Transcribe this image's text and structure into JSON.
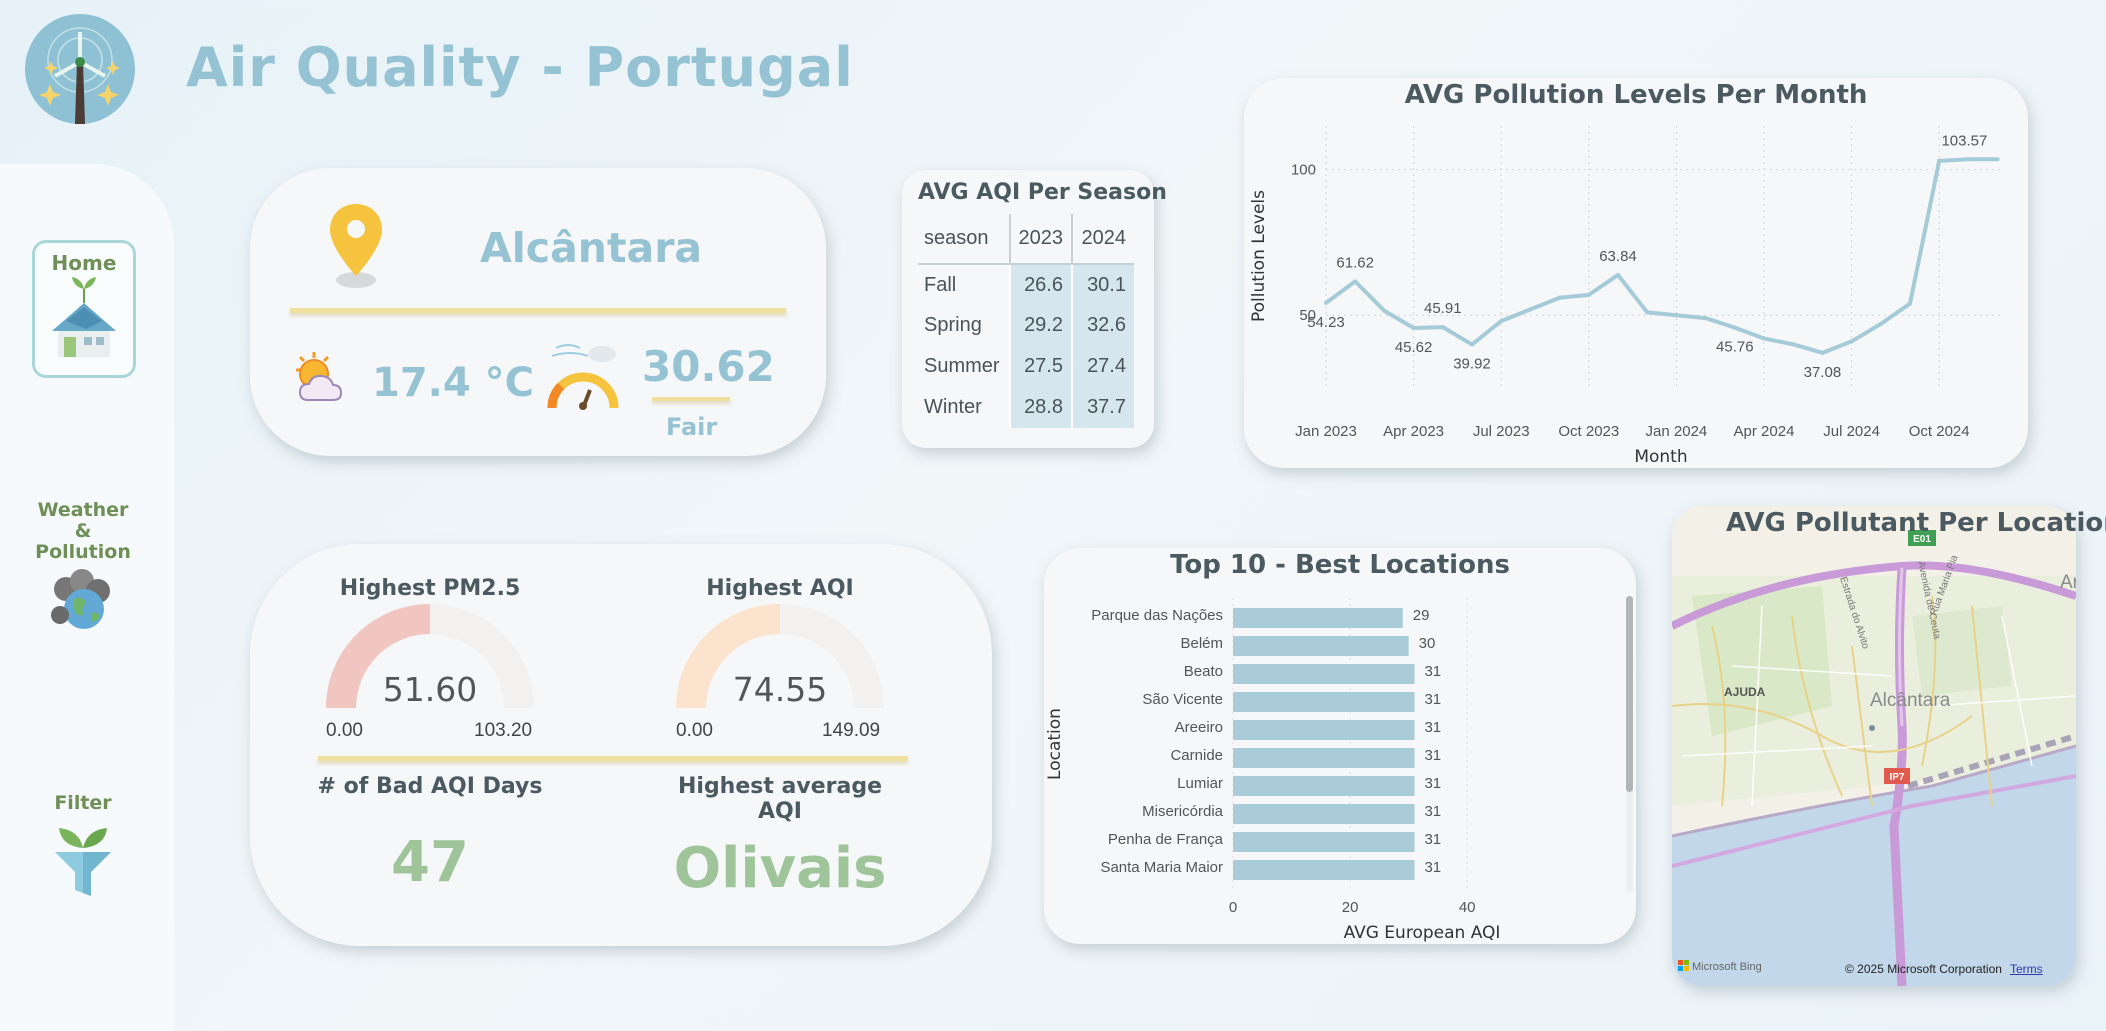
{
  "app": {
    "title": "Air Quality - Portugal"
  },
  "sidebar": {
    "items": [
      {
        "label": "Home"
      },
      {
        "label": "Weather\n&\nPollution"
      },
      {
        "label": "Filter"
      }
    ]
  },
  "location_card": {
    "location": "Alcântara",
    "temperature": "17.4 °C",
    "aqi": "30.62",
    "aqi_category": "Fair"
  },
  "season_table": {
    "title": "AVG AQI Per Season",
    "columns": [
      "season",
      "2023",
      "2024"
    ],
    "rows": [
      [
        "Fall",
        "26.6",
        "30.1"
      ],
      [
        "Spring",
        "29.2",
        "32.6"
      ],
      [
        "Summer",
        "27.5",
        "27.4"
      ],
      [
        "Winter",
        "28.8",
        "37.7"
      ]
    ]
  },
  "kpis": {
    "pm25_title": "Highest PM2.5",
    "pm25_value": "51.60",
    "pm25_min": "0.00",
    "pm25_max": "103.20",
    "pm25_fraction": 0.5,
    "aqi_title": "Highest AQI",
    "aqi_value": "74.55",
    "aqi_min": "0.00",
    "aqi_max": "149.09",
    "aqi_fraction": 0.5,
    "bad_days_title": "# of Bad AQI Days",
    "bad_days_value": "47",
    "highest_avg_title": "Highest average AQI",
    "highest_avg_value": "Olivais"
  },
  "map": {
    "title": "AVG Pollutant Per Location",
    "place_label": "Alcântara",
    "district_label": "AJUDA",
    "road_labels": [
      "E01",
      "IP7"
    ],
    "street_labels": [
      "Estrada do Alvito",
      "Avenida de Ceuta",
      "Rua Maria Pia"
    ],
    "edge_label": "Ar",
    "provider": "Microsoft Bing",
    "copyright": "© 2025 Microsoft Corporation",
    "terms": "Terms"
  },
  "colors": {
    "accent": "#95c3d3",
    "line": "#a5cbd8",
    "bar": "#a9ccd8",
    "kpi_green": "#9fc49a",
    "gauge_pm": "#f1c6c0",
    "gauge_aqi": "#fce3cd"
  },
  "chart_data": [
    {
      "type": "line",
      "title": "AVG Pollution Levels Per Month",
      "xlabel": "Month",
      "ylabel": "Pollution Levels",
      "x": [
        "2023-01",
        "2023-02",
        "2023-03",
        "2023-04",
        "2023-05",
        "2023-06",
        "2023-07",
        "2023-08",
        "2023-09",
        "2023-10",
        "2023-11",
        "2023-12",
        "2024-01",
        "2024-02",
        "2024-03",
        "2024-04",
        "2024-05",
        "2024-06",
        "2024-07",
        "2024-08",
        "2024-09",
        "2024-10",
        "2024-11",
        "2024-12"
      ],
      "x_tick_labels": [
        "Jan 2023",
        "Apr 2023",
        "Jul 2023",
        "Oct 2023",
        "Jan 2024",
        "Apr 2024",
        "Jul 2024",
        "Oct 2024"
      ],
      "y_ticks": [
        "50",
        "100"
      ],
      "y": [
        54.23,
        61.62,
        51.5,
        45.62,
        45.91,
        39.92,
        48,
        52,
        56,
        57,
        63.84,
        51,
        50,
        49,
        45.76,
        42,
        40,
        37.08,
        41,
        47,
        54,
        103,
        103.57,
        103.57
      ],
      "data_labels": [
        {
          "i": 0,
          "text": "54.23"
        },
        {
          "i": 1,
          "text": "61.62"
        },
        {
          "i": 3,
          "text": "45.62"
        },
        {
          "i": 4,
          "text": "45.91"
        },
        {
          "i": 5,
          "text": "39.92"
        },
        {
          "i": 10,
          "text": "63.84"
        },
        {
          "i": 14,
          "text": "45.76"
        },
        {
          "i": 17,
          "text": "37.08"
        },
        {
          "i": 22,
          "text": "103.57"
        }
      ],
      "ylim": [
        25,
        115
      ],
      "grid": true
    },
    {
      "type": "bar",
      "orientation": "horizontal",
      "title": "Top 10 - Best Locations",
      "xlabel": "AVG European AQI",
      "ylabel": "Location",
      "categories": [
        "Parque das Nações",
        "Belém",
        "Beato",
        "São Vicente",
        "Areeiro",
        "Carnide",
        "Lumiar",
        "Misericórdia",
        "Penha de França",
        "Santa Maria Maior"
      ],
      "values": [
        29,
        30,
        31,
        31,
        31,
        31,
        31,
        31,
        31,
        31
      ],
      "x_ticks": [
        "0",
        "20",
        "40"
      ],
      "xlim": [
        0,
        48
      ],
      "grid": true
    }
  ]
}
